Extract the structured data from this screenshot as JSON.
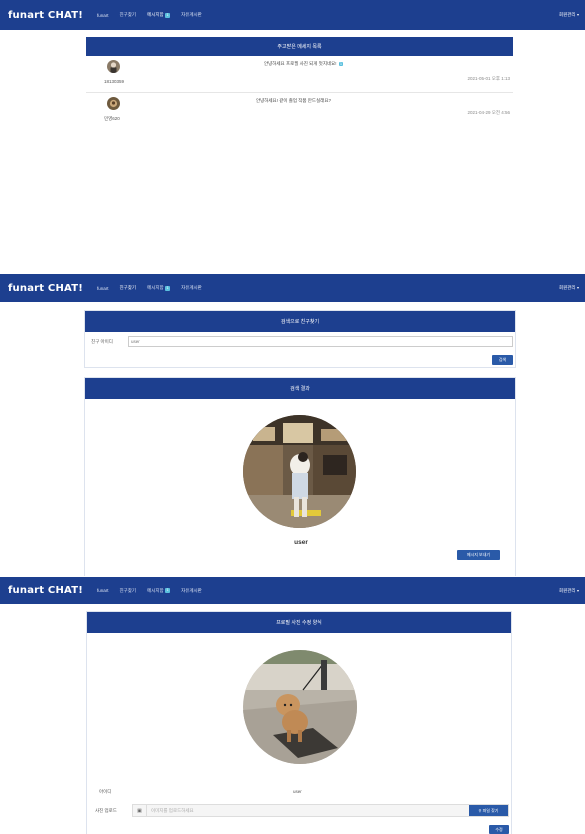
{
  "nav": {
    "brand": "funart CHAT!",
    "items": [
      "funart",
      "친구찾기",
      "메시지함",
      "자유게시판"
    ],
    "badge": "1",
    "user_menu": "회원관리"
  },
  "messages_panel": {
    "title": "주고받은 메세지 목록",
    "rows": [
      {
        "sender": "18130359",
        "text": "안녕하세요 프로필 사진 되게 멋지네요!",
        "badge": "1",
        "time": "2021-05-01 오후 1:13"
      },
      {
        "sender": "민영620",
        "text": "안녕하세요! 같이 졸업 작품 만드실래요?",
        "time": "2021-04-29 오전 4:56"
      }
    ]
  },
  "search_panel": {
    "title": "검색으로 친구찾기",
    "label": "친구 아이디",
    "value": "user",
    "search_button": "검색"
  },
  "result_panel": {
    "title": "검색 결과",
    "name": "user",
    "message_button": "메시지 보내기"
  },
  "profile_panel": {
    "title": "프로필 사진 수정 양식",
    "id_label": "아이디",
    "id_value": "user",
    "upload_label": "사진 업로드",
    "upload_placeholder": "이미지를 업로드하세요",
    "find_button": "파일 찾기",
    "submit_button": "수정"
  },
  "colors": {
    "navbar": "#1d3f8f",
    "accent": "#2a5aa8",
    "badge": "#5bc0de"
  }
}
